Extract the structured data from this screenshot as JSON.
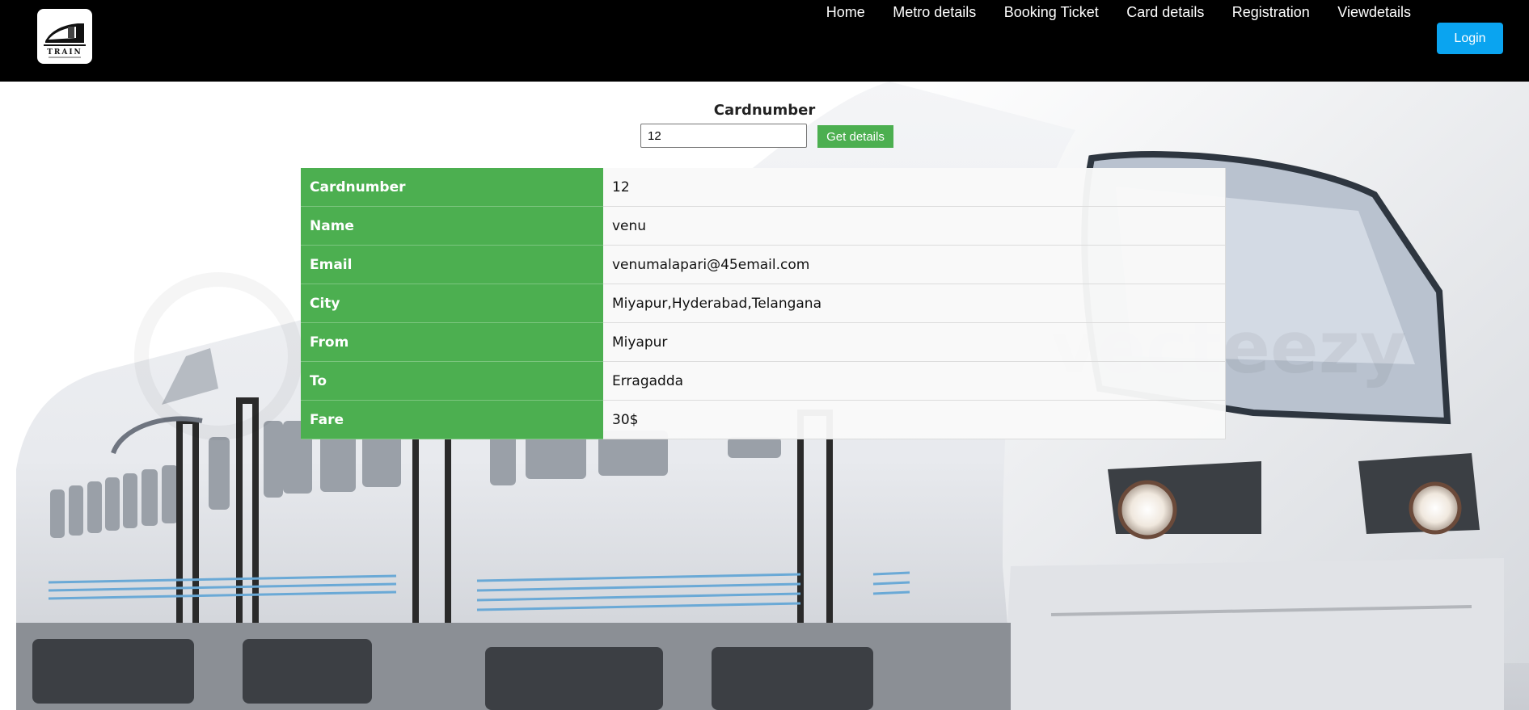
{
  "header": {
    "logo_text": "TRAIN",
    "nav": [
      "Home",
      "Metro details",
      "Booking Ticket",
      "Card details",
      "Registration",
      "Viewdetails"
    ],
    "login_label": "Login"
  },
  "form": {
    "label": "Cardnumber",
    "input_value": "12",
    "button_label": "Get details"
  },
  "details": [
    {
      "key": "Cardnumber",
      "value": "12"
    },
    {
      "key": "Name",
      "value": "venu"
    },
    {
      "key": "Email",
      "value": "venumalapari@45email.com"
    },
    {
      "key": "City",
      "value": "Miyapur,Hyderabad,Telangana"
    },
    {
      "key": "From",
      "value": "Miyapur"
    },
    {
      "key": "To",
      "value": "Erragadda"
    },
    {
      "key": "Fare",
      "value": "30$"
    }
  ],
  "watermark": "vecteezy",
  "colors": {
    "header_bg": "#000000",
    "login_bg": "#0aa4f0",
    "accent_green": "#4caf50"
  }
}
